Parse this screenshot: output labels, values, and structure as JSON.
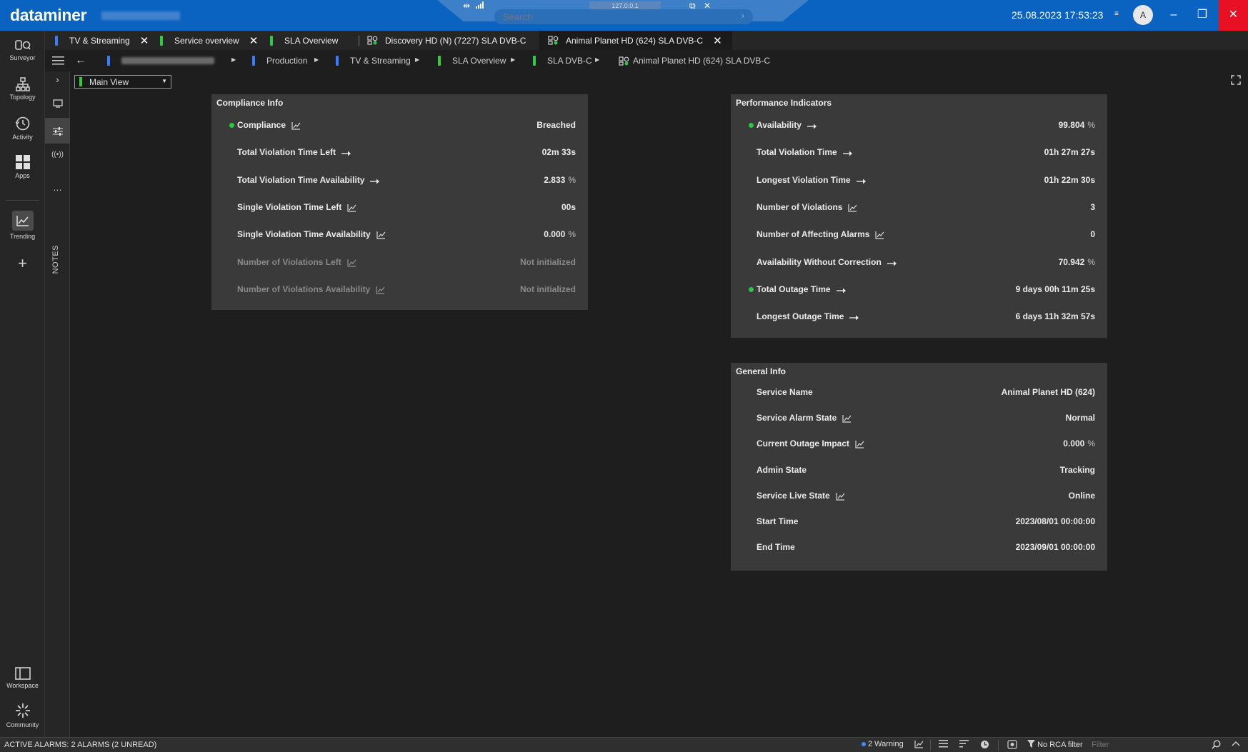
{
  "app": {
    "logo": "dataminer"
  },
  "titlebar": {
    "search_placeholder": "Search",
    "search_arrow": "›",
    "connection": "127.0.0.1",
    "datetime": "25.08.2023 17:53:23",
    "datetime_dropdown": "≡",
    "user_initial": "A",
    "min": "–",
    "max": "❐",
    "close": "✕"
  },
  "leftnav": {
    "items": [
      {
        "label": "Surveyor",
        "icon": "surveyor-icon"
      },
      {
        "label": "Topology",
        "icon": "topology-icon"
      },
      {
        "label": "Activity",
        "icon": "activity-icon"
      },
      {
        "label": "Apps",
        "icon": "apps-icon"
      },
      {
        "label": "Trending",
        "icon": "trending-icon"
      },
      {
        "label": "Workspace",
        "icon": "workspace-icon"
      },
      {
        "label": "Community",
        "icon": "community-icon"
      }
    ],
    "add": "+"
  },
  "strip": {
    "notes_label": "NOTES",
    "more": "…"
  },
  "tabs": [
    {
      "label": "TV & Streaming",
      "stripe": "#3a7bff",
      "closable": true
    },
    {
      "label": "Service overview",
      "stripe": "#2ecc40",
      "closable": true
    },
    {
      "label": "SLA Overview",
      "stripe": "#2ecc40",
      "closable": false
    },
    {
      "label": "Discovery HD (N) (7227) SLA DVB-C",
      "stripe": "",
      "closable": false
    },
    {
      "label": "Animal Planet HD (624) SLA DVB-C",
      "stripe": "",
      "closable": true
    }
  ],
  "tab_close": "✕",
  "breadcrumb": [
    {
      "label": "Production",
      "stripe": "#3a7bff"
    },
    {
      "label": "TV & Streaming",
      "stripe": "#3a7bff"
    },
    {
      "label": "SLA Overview",
      "stripe": "#2ecc40"
    },
    {
      "label": "SLA DVB-C",
      "stripe": "#2ecc40"
    },
    {
      "label": "Animal Planet HD (624) SLA DVB-C",
      "stripe": ""
    }
  ],
  "breadcrumb_sep": "▶",
  "view_selector": {
    "value": "Main View",
    "arrow": "▼"
  },
  "compliance": {
    "title": "Compliance Info",
    "rows": [
      {
        "label": "Compliance",
        "value": "Breached",
        "unit": "",
        "icon": "trend",
        "dot": true,
        "dim": false
      },
      {
        "label": "Total Violation Time Left",
        "value": "02m 33s",
        "unit": "",
        "icon": "arrow",
        "dot": false,
        "dim": false
      },
      {
        "label": "Total Violation Time Availability",
        "value": "2.833",
        "unit": "%",
        "icon": "arrow",
        "dot": false,
        "dim": false
      },
      {
        "label": "Single Violation Time Left",
        "value": "00s",
        "unit": "",
        "icon": "trend",
        "dot": false,
        "dim": false
      },
      {
        "label": "Single Violation Time Availability",
        "value": "0.000",
        "unit": "%",
        "icon": "trend",
        "dot": false,
        "dim": false
      },
      {
        "label": "Number of Violations Left",
        "value": "Not initialized",
        "unit": "",
        "icon": "trend",
        "dot": false,
        "dim": true
      },
      {
        "label": "Number of Violations Availability",
        "value": "Not initialized",
        "unit": "",
        "icon": "trend",
        "dot": false,
        "dim": true
      }
    ]
  },
  "performance": {
    "title": "Performance Indicators",
    "rows": [
      {
        "label": "Availability",
        "value": "99.804",
        "unit": "%",
        "icon": "arrow",
        "dot": true
      },
      {
        "label": "Total Violation Time",
        "value": "01h 27m 27s",
        "unit": "",
        "icon": "arrow",
        "dot": false
      },
      {
        "label": "Longest Violation Time",
        "value": "01h 22m 30s",
        "unit": "",
        "icon": "arrow",
        "dot": false
      },
      {
        "label": "Number of Violations",
        "value": "3",
        "unit": "",
        "icon": "trend",
        "dot": false
      },
      {
        "label": "Number of Affecting Alarms",
        "value": "0",
        "unit": "",
        "icon": "trend",
        "dot": false
      },
      {
        "label": "Availability Without Correction",
        "value": "70.942",
        "unit": "%",
        "icon": "arrow",
        "dot": false
      },
      {
        "label": "Total Outage Time",
        "value": "9 days 00h 11m 25s",
        "unit": "",
        "icon": "arrow",
        "dot": true
      },
      {
        "label": "Longest Outage Time",
        "value": "6 days 11h 32m 57s",
        "unit": "",
        "icon": "arrow",
        "dot": false
      }
    ]
  },
  "general": {
    "title": "General Info",
    "rows": [
      {
        "label": "Service Name",
        "value": "Animal Planet HD (624)",
        "unit": "",
        "icon": ""
      },
      {
        "label": "Service Alarm State",
        "value": "Normal",
        "unit": "",
        "icon": "trend"
      },
      {
        "label": "Current Outage Impact",
        "value": "0.000",
        "unit": "%",
        "icon": "trend"
      },
      {
        "label": "Admin State",
        "value": "Tracking",
        "unit": "",
        "icon": ""
      },
      {
        "label": "Service Live State",
        "value": "Online",
        "unit": "",
        "icon": "trend"
      },
      {
        "label": "Start Time",
        "value": "2023/08/01 00:00:00",
        "unit": "",
        "icon": ""
      },
      {
        "label": "End Time",
        "value": "2023/09/01 00:00:00",
        "unit": "",
        "icon": ""
      }
    ]
  },
  "statusbar": {
    "alarms": "ACTIVE ALARMS: 2 ALARMS (2 UNREAD)",
    "warning": "2 Warning",
    "rca": "No RCA filter",
    "filter_placeholder": "Filter"
  },
  "colors": {
    "titlebar": "#0b63c1",
    "close": "#e81123",
    "ok": "#27c93f",
    "panel": "#3a3a3a"
  }
}
